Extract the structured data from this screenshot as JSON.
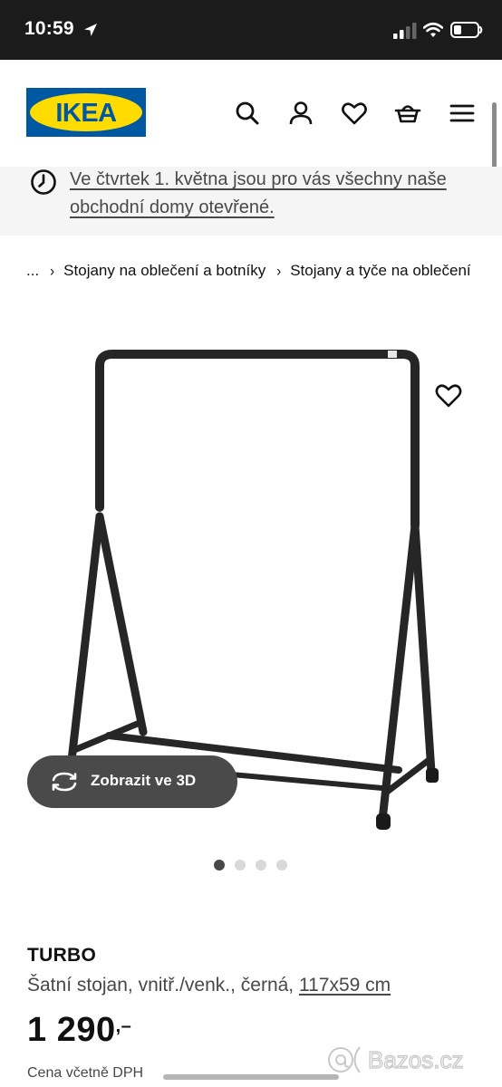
{
  "status_bar": {
    "time": "10:59",
    "icons": [
      "location-arrow-icon",
      "signal-icon",
      "wifi-icon",
      "battery-icon"
    ]
  },
  "header": {
    "logo_text": "IKEA",
    "brand_colors": {
      "blue": "#0058a3",
      "yellow": "#ffdb00"
    },
    "icons": [
      "search-icon",
      "user-icon",
      "heart-icon",
      "basket-icon",
      "menu-icon"
    ]
  },
  "banner": {
    "icon": "clock-icon",
    "text": "Ve čtvrtek 1. května jsou pro vás všechny naše obchodní domy otevřené."
  },
  "breadcrumb": {
    "items": [
      "...",
      "Stojany na oblečení a botníky",
      "Stojany a tyče na oblečení"
    ],
    "separator_icon": "chevron-right-icon"
  },
  "product_image": {
    "favorite_icon": "heart-outline-icon",
    "view_3d_icon": "rotate-3d-icon",
    "view_3d_label": "Zobrazit ve 3D",
    "dot_count": 4,
    "active_dot": 0
  },
  "product": {
    "name": "TURBO",
    "description": "Šatní stojan, vnitř./venk., černá, ",
    "size": "117x59 cm",
    "price": "1 290",
    "price_suffix": ",–",
    "vat_note": "Cena včetně DPH"
  },
  "watermark": {
    "text": "Bazos.cz"
  }
}
